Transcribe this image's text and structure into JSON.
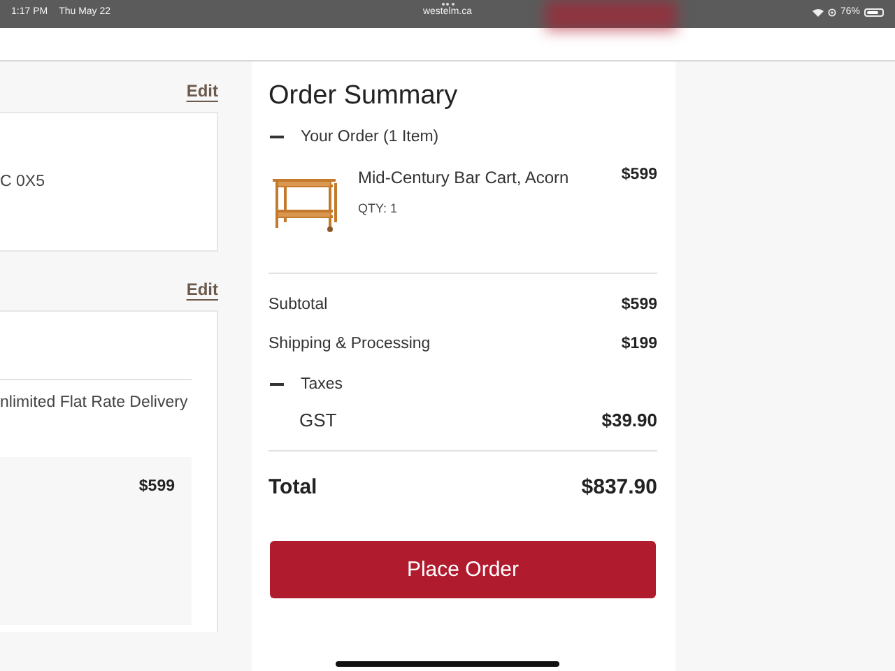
{
  "status_bar": {
    "time": "1:17 PM",
    "date": "Thu May 22",
    "url": "westelm.ca",
    "battery": "76%"
  },
  "left_column": {
    "sections": [
      {
        "edit": "Edit",
        "lines": [
          "C 0X5"
        ]
      },
      {
        "edit": "Edit",
        "delivery": "nlimited Flat Rate Delivery",
        "item_price": "$599"
      }
    ]
  },
  "order_summary": {
    "title": "Order Summary",
    "items_toggle": {
      "label": "Your Order (1 Item)",
      "expanded": true
    },
    "items": [
      {
        "name": "Mid-Century Bar Cart, Acorn",
        "qty": "QTY: 1",
        "price": "$599"
      }
    ],
    "lines": [
      {
        "label": "Subtotal",
        "value": "$599"
      },
      {
        "label": "Shipping & Processing",
        "value": "$199"
      }
    ],
    "taxes": {
      "label": "Taxes",
      "expanded": true,
      "lines": [
        {
          "label": "GST",
          "value": "$39.90"
        }
      ]
    },
    "total": {
      "label": "Total",
      "value": "$837.90"
    },
    "button": "Place Order"
  }
}
